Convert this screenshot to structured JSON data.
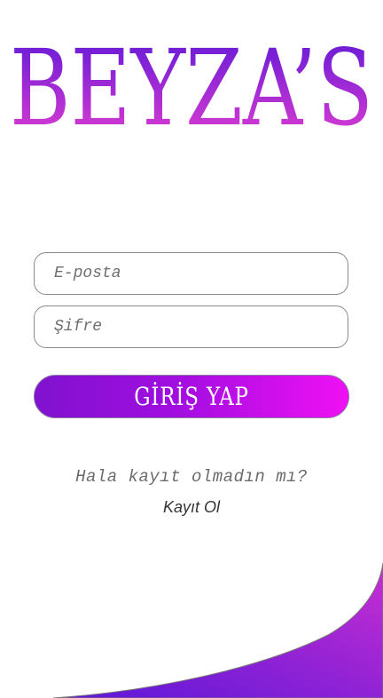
{
  "app": {
    "logo_text": "BEYZA’S",
    "colors": {
      "primary": "#5a17d8",
      "accent": "#e63fd0",
      "button_end": "#f010f4"
    }
  },
  "login_form": {
    "email_placeholder": "E-posta",
    "password_placeholder": "Şifre",
    "submit_label": "GİRİŞ YAP"
  },
  "footer": {
    "prompt_text": "Hala kayıt olmadın mı?",
    "register_link": "Kayıt Ol"
  }
}
